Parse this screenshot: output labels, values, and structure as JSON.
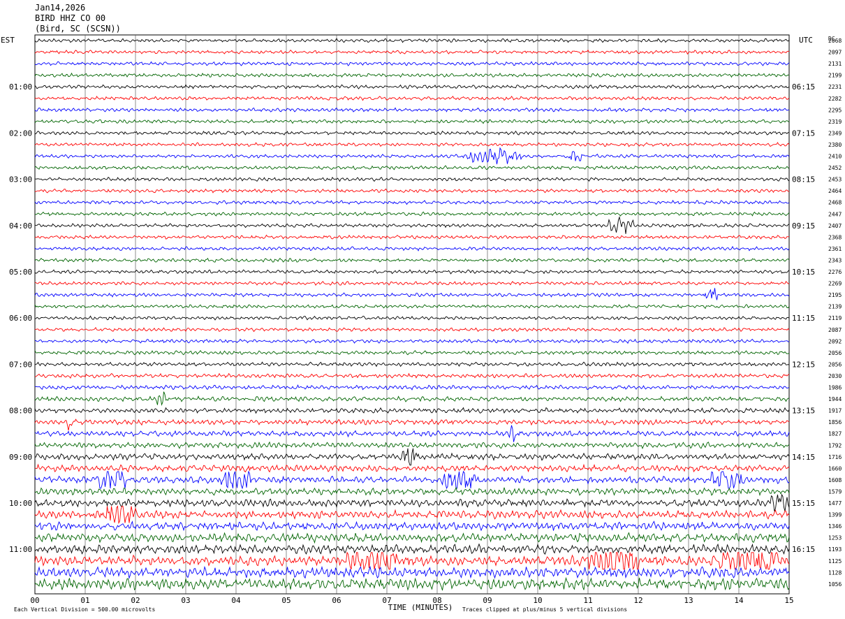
{
  "header": {
    "date": "Jan14,2026",
    "station": "BIRD HHZ CO 00",
    "location": "(Bird, SC (SCSN))"
  },
  "chart_data": {
    "type": "line",
    "title": "BIRD HHZ CO 00",
    "left_axis_label": "EST",
    "right_axis_label": "UTC",
    "dc_label": "DC",
    "xlabel": "TIME (MINUTES)",
    "xlim": [
      0,
      15
    ],
    "x_ticks": [
      "00",
      "01",
      "02",
      "03",
      "04",
      "05",
      "06",
      "07",
      "08",
      "09",
      "10",
      "11",
      "12",
      "13",
      "14",
      "15"
    ],
    "left_hour_labels": [
      "01:00",
      "02:00",
      "03:00",
      "04:00",
      "05:00",
      "06:00",
      "07:00",
      "08:00",
      "09:00",
      "10:00",
      "11:00"
    ],
    "right_hour_labels": [
      "06:15",
      "07:15",
      "08:15",
      "09:15",
      "10:15",
      "11:15",
      "12:15",
      "13:15",
      "14:15",
      "15:15",
      "16:15"
    ],
    "trace_colors": [
      "#000000",
      "#ff0000",
      "#0000ff",
      "#006400"
    ],
    "dc_offsets": [
      2068,
      2097,
      2131,
      2199,
      2231,
      2282,
      2295,
      2319,
      2349,
      2380,
      2410,
      2452,
      2453,
      2464,
      2468,
      2447,
      2407,
      2368,
      2361,
      2343,
      2276,
      2269,
      2195,
      2139,
      2119,
      2087,
      2092,
      2056,
      2056,
      2030,
      1986,
      1944,
      1917,
      1856,
      1827,
      1792,
      1716,
      1660,
      1608,
      1579,
      1477,
      1399,
      1346,
      1253,
      1193,
      1125,
      1128,
      1056
    ],
    "trace_amplitude": [
      1,
      1,
      1,
      1,
      1,
      1,
      1,
      1,
      1,
      1,
      1,
      1,
      1,
      1,
      1,
      1,
      1,
      1,
      1,
      1,
      1,
      1,
      1,
      1,
      1,
      1,
      1,
      1.05,
      1.1,
      1.15,
      1.2,
      1.3,
      1.35,
      1.45,
      1.5,
      1.6,
      1.7,
      1.8,
      1.9,
      2,
      2.1,
      2.2,
      2.3,
      2.4,
      2.5,
      2.7,
      2.9,
      3.2
    ],
    "bursts": [
      {
        "trace": 10,
        "start": 8.6,
        "end": 9.7,
        "amp": 2.2
      },
      {
        "trace": 10,
        "start": 10.6,
        "end": 10.9,
        "amp": 1.8
      },
      {
        "trace": 16,
        "start": 11.4,
        "end": 11.9,
        "amp": 2
      },
      {
        "trace": 22,
        "start": 13.3,
        "end": 13.6,
        "amp": 2.4
      },
      {
        "trace": 31,
        "start": 2.4,
        "end": 2.6,
        "amp": 1.8
      },
      {
        "trace": 33,
        "start": 0.6,
        "end": 0.8,
        "amp": 1.8
      },
      {
        "trace": 34,
        "start": 9.4,
        "end": 9.6,
        "amp": 2
      },
      {
        "trace": 36,
        "start": 7.3,
        "end": 7.6,
        "amp": 2.2
      },
      {
        "trace": 38,
        "start": 1.2,
        "end": 1.8,
        "amp": 1.8
      },
      {
        "trace": 38,
        "start": 3.7,
        "end": 4.3,
        "amp": 2
      },
      {
        "trace": 38,
        "start": 8.1,
        "end": 8.8,
        "amp": 1.9
      },
      {
        "trace": 38,
        "start": 13.4,
        "end": 14.1,
        "amp": 1.8
      },
      {
        "trace": 40,
        "start": 14.6,
        "end": 15.0,
        "amp": 2
      },
      {
        "trace": 41,
        "start": 1.4,
        "end": 2.0,
        "amp": 1.6
      },
      {
        "trace": 45,
        "start": 6.2,
        "end": 7.2,
        "amp": 1.6
      },
      {
        "trace": 45,
        "start": 11.0,
        "end": 12.0,
        "amp": 1.6
      },
      {
        "trace": 45,
        "start": 13.6,
        "end": 14.8,
        "amp": 1.8
      }
    ]
  },
  "footer": {
    "scale_note": "Each Vertical Division =  500.00 microvolts",
    "clip_note": "Traces clipped at plus/minus 5 vertical divisions"
  }
}
